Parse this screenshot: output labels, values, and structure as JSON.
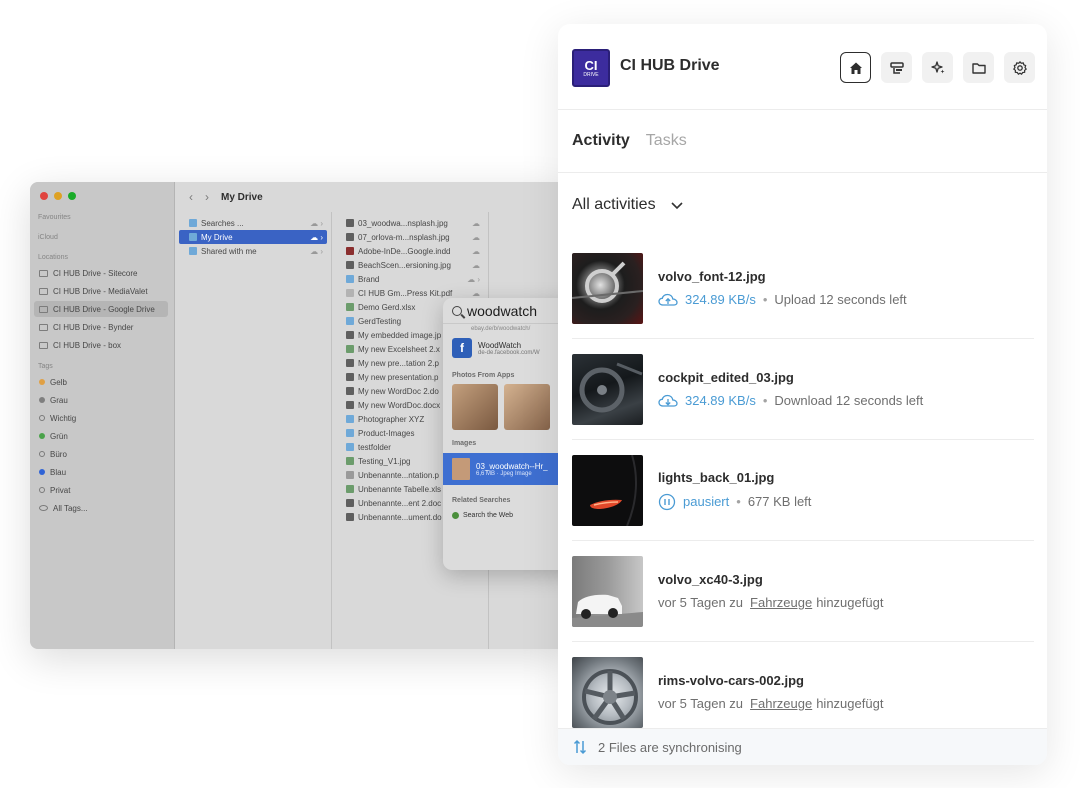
{
  "finder": {
    "window_title": "My Drive",
    "sidebar": {
      "favourites": "Favourites",
      "icloud": "iCloud",
      "locations_header": "Locations",
      "locations": [
        "CI HUB Drive - Sitecore",
        "CI HUB Drive - MediaValet",
        "CI HUB Drive - Google Drive",
        "CI HUB Drive - Bynder",
        "CI HUB Drive - box"
      ],
      "tags_header": "Tags",
      "tags": [
        {
          "label": "Gelb",
          "color": "#e0a044"
        },
        {
          "label": "Grau",
          "color": "#7f7f7f"
        },
        {
          "label": "Wichtig",
          "color": ""
        },
        {
          "label": "Grün",
          "color": "#4aa24a"
        },
        {
          "label": "Büro",
          "color": ""
        },
        {
          "label": "Blau",
          "color": "#2f63d6"
        },
        {
          "label": "Privat",
          "color": ""
        },
        {
          "label": "All Tags...",
          "color": ""
        }
      ]
    },
    "col1": [
      "Searches ...",
      "My Drive",
      "Shared with me"
    ],
    "col2": [
      "03_woodwa...nsplash.jpg",
      "07_orlova-m...nsplash.jpg",
      "Adobe-InDe...Google.indd",
      "BeachScen...ersioning.jpg",
      "Brand",
      "CI HUB Gm...Press Kit.pdf",
      "Demo Gerd.xlsx",
      "GerdTesting",
      "My embedded image.jp",
      "My new Excelsheet 2.x",
      "My new pre...tation 2.p",
      "My new presentation.p",
      "My new WordDoc 2.do",
      "My new WordDoc.docx",
      "Photographer XYZ",
      "Product-Images",
      "testfolder",
      "Testing_V1.jpg",
      "Unbenannte...ntation.p",
      "Unbenannte Tabelle.xls",
      "Unbenannte...ent 2.doc",
      "Unbenannte...ument.do"
    ],
    "spotlight": {
      "query": "woodwatch",
      "top_sub": "ebay.de/b/woodwatch/",
      "result_title": "WoodWatch",
      "result_sub": "de-de.facebook.com/W",
      "photos_header": "Photos From Apps",
      "images_header": "Images",
      "image_title": "03_woodwatch--Hr_",
      "image_sub": "6,6 MB · Jpeg Image",
      "related_header": "Related Searches",
      "related_item": "Search the Web"
    }
  },
  "panel": {
    "logo_text": "CI",
    "logo_sub": "DRIVE",
    "title": "CI HUB Drive",
    "header_buttons": [
      {
        "name": "home-icon"
      },
      {
        "name": "server-icon"
      },
      {
        "name": "sparkle-icon"
      },
      {
        "name": "folder-icon"
      },
      {
        "name": "gear-icon"
      }
    ],
    "tabs": {
      "activity": "Activity",
      "tasks": "Tasks"
    },
    "filter": "All activities",
    "items": [
      {
        "name": "volvo_font-12.jpg",
        "speed": "324.89 KB/s",
        "status": "Upload 12 seconds left"
      },
      {
        "name": "cockpit_edited_03.jpg",
        "speed": "324.89 KB/s",
        "status": "Download 12 seconds left"
      },
      {
        "name": "lights_back_01.jpg",
        "speed": "pausiert",
        "status": "677 KB left"
      },
      {
        "name": "volvo_xc40-3.jpg",
        "pre": "vor 5 Tagen zu",
        "link": "Fahrzeuge",
        "post": "hinzugefügt"
      },
      {
        "name": "rims-volvo-cars-002.jpg",
        "pre": "vor 5 Tagen zu",
        "link": "Fahrzeuge",
        "post": "hinzugefügt"
      }
    ],
    "footer": "2 Files are synchronising"
  }
}
